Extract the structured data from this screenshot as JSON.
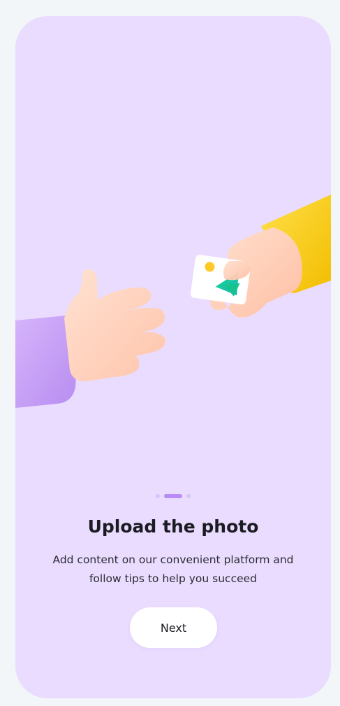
{
  "onboarding": {
    "title": "Upload the photo",
    "subtitle": "Add content on our convenient platform and follow tips to help you succeed",
    "next_label": "Next",
    "pagination": {
      "total": 3,
      "current": 2
    }
  },
  "illustration": {
    "description_icon": "hands-passing-photo-illustration",
    "photo_card_icon": "image-icon"
  },
  "colors": {
    "background": "#eadcff",
    "page_background": "#f3f6f8",
    "accent": "#b98cf5",
    "sleeve_left": "#c9a2f6",
    "sleeve_right": "#ffd21a",
    "skin": "#ffd6c2",
    "button_bg": "#ffffff"
  }
}
